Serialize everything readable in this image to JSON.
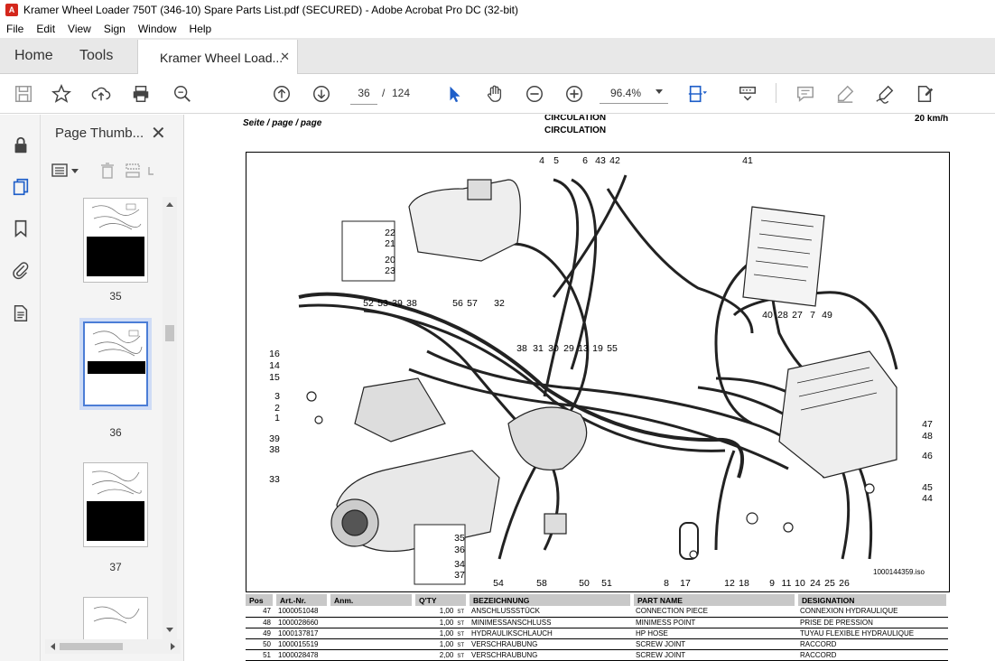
{
  "window": {
    "title": "Kramer Wheel Loader 750T (346-10) Spare Parts List.pdf (SECURED) - Adobe Acrobat Pro DC (32-bit)",
    "app_icon_glyph": "A"
  },
  "menu": [
    "File",
    "Edit",
    "View",
    "Sign",
    "Window",
    "Help"
  ],
  "tabs": {
    "home": "Home",
    "tools": "Tools",
    "document": "Kramer Wheel Load...",
    "close_glyph": "✕"
  },
  "toolbar": {
    "current_page": "36",
    "separator": "/",
    "total_pages": "124",
    "zoom": "96.4%"
  },
  "thumbnail_panel": {
    "title": "Page Thumb...",
    "close_glyph": "✕",
    "pages": [
      {
        "label": "35",
        "selected": false
      },
      {
        "label": "36",
        "selected": true
      },
      {
        "label": "37",
        "selected": false
      },
      {
        "label": "",
        "selected": false
      }
    ]
  },
  "document": {
    "page_label": "Seite / page / page",
    "heading_1": "CIRCULATION",
    "heading_2": "CIRCULATION",
    "speed": "20 km/h",
    "diagram_ref": "1000144359.iso",
    "callouts": [
      {
        "id": "4"
      },
      {
        "id": "5"
      },
      {
        "id": "6"
      },
      {
        "id": "43"
      },
      {
        "id": "42"
      },
      {
        "id": "41"
      },
      {
        "id": "22"
      },
      {
        "id": "21"
      },
      {
        "id": "20"
      },
      {
        "id": "23"
      },
      {
        "id": "56"
      },
      {
        "id": "57"
      },
      {
        "id": "32"
      },
      {
        "id": "52"
      },
      {
        "id": "53"
      },
      {
        "id": "39"
      },
      {
        "id": "38"
      },
      {
        "id": "40"
      },
      {
        "id": "28"
      },
      {
        "id": "27"
      },
      {
        "id": "7"
      },
      {
        "id": "49"
      },
      {
        "id": "16"
      },
      {
        "id": "14"
      },
      {
        "id": "15"
      },
      {
        "id": "38"
      },
      {
        "id": "31"
      },
      {
        "id": "30"
      },
      {
        "id": "29"
      },
      {
        "id": "13"
      },
      {
        "id": "19"
      },
      {
        "id": "55"
      },
      {
        "id": "3"
      },
      {
        "id": "2"
      },
      {
        "id": "1"
      },
      {
        "id": "47"
      },
      {
        "id": "48"
      },
      {
        "id": "46"
      },
      {
        "id": "39"
      },
      {
        "id": "38"
      },
      {
        "id": "33"
      },
      {
        "id": "45"
      },
      {
        "id": "44"
      },
      {
        "id": "35"
      },
      {
        "id": "36"
      },
      {
        "id": "34"
      },
      {
        "id": "37"
      },
      {
        "id": "54"
      },
      {
        "id": "58"
      },
      {
        "id": "50"
      },
      {
        "id": "51"
      },
      {
        "id": "8"
      },
      {
        "id": "17"
      },
      {
        "id": "12"
      },
      {
        "id": "18"
      },
      {
        "id": "9"
      },
      {
        "id": "11"
      },
      {
        "id": "10"
      },
      {
        "id": "24"
      },
      {
        "id": "25"
      },
      {
        "id": "26"
      }
    ]
  },
  "parts_table": {
    "headers": [
      "Pos",
      "Art.-Nr.",
      "Anm.",
      "Q'TY",
      "BEZEICHNUNG",
      "PART NAME",
      "DESIGNATION"
    ],
    "rows": [
      {
        "pos": "47",
        "art": "1000051048",
        "anm": "",
        "qty": "1,00",
        "unit": "ST",
        "bez": "ANSCHLUSSSTÜCK",
        "part": "CONNECTION PIECE",
        "des": "CONNEXION HYDRAULIQUE"
      },
      {
        "pos": "48",
        "art": "1000028660",
        "anm": "",
        "qty": "1,00",
        "unit": "ST",
        "bez": "MINIMESSANSCHLUSS",
        "part": "MINIMESS POINT",
        "des": "PRISE DE PRESSION"
      },
      {
        "pos": "49",
        "art": "1000137817",
        "anm": "",
        "qty": "1,00",
        "unit": "ST",
        "bez": "HYDRAULIKSCHLAUCH",
        "part": "HP HOSE",
        "des": "TUYAU FLEXIBLE HYDRAULIQUE"
      },
      {
        "pos": "50",
        "art": "1000015519",
        "anm": "",
        "qty": "1,00",
        "unit": "ST",
        "bez": "VERSCHRAUBUNG",
        "part": "SCREW JOINT",
        "des": "RACCORD"
      },
      {
        "pos": "51",
        "art": "1000028478",
        "anm": "",
        "qty": "2,00",
        "unit": "ST",
        "bez": "VERSCHRAUBUNG",
        "part": "SCREW JOINT",
        "des": "RACCORD"
      }
    ]
  }
}
